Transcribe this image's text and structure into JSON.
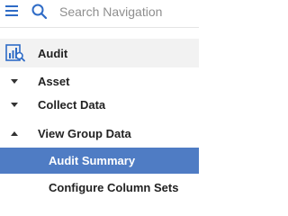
{
  "search": {
    "placeholder": "Search Navigation",
    "icon": "search-icon",
    "menu_icon": "hamburger-menu-icon"
  },
  "app": {
    "icon": "audit-report-icon",
    "label": "Audit"
  },
  "menu": {
    "items": [
      {
        "label": "Asset",
        "state": "collapsed",
        "icon": "caret-down-icon"
      },
      {
        "label": "Collect Data",
        "state": "collapsed",
        "icon": "caret-down-icon"
      },
      {
        "label": "View Group Data",
        "state": "expanded",
        "icon": "caret-up-icon"
      }
    ],
    "subitems": [
      {
        "label": "Audit Summary",
        "selected": true
      },
      {
        "label": "Configure Column Sets",
        "selected": false
      }
    ]
  },
  "colors": {
    "accent": "#2e6bc6",
    "selected_bg": "#4f7cc4",
    "header_bg": "#f2f2f2"
  }
}
